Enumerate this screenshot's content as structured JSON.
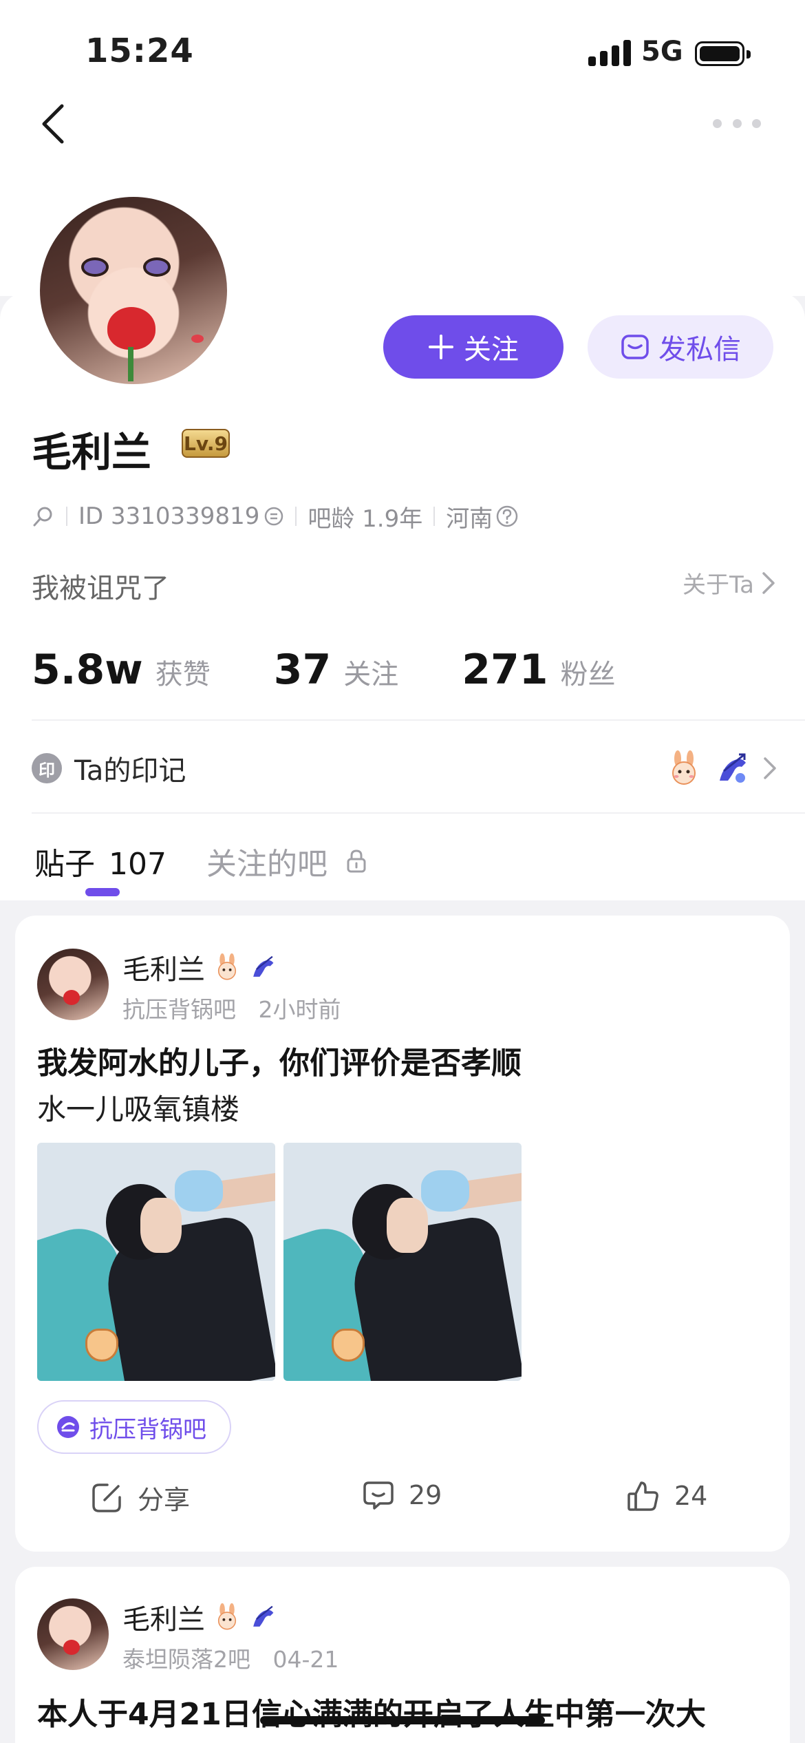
{
  "status_bar": {
    "time": "15:24",
    "network": "5G"
  },
  "profile": {
    "name": "毛利兰",
    "level": "Lv.9",
    "id_text": "ID 3310339819",
    "bar_age": "吧龄 1.9年",
    "location": "河南",
    "bio": "我被诅咒了",
    "about_label": "关于Ta",
    "follow_label": "关注",
    "message_label": "发私信"
  },
  "stats": [
    {
      "value": "5.8w",
      "label": "获赞"
    },
    {
      "value": "37",
      "label": "关注"
    },
    {
      "value": "271",
      "label": "粉丝"
    }
  ],
  "marks": {
    "label": "Ta的印记",
    "icon_text": "印"
  },
  "tabs": {
    "posts_label": "贴子",
    "posts_count": "107",
    "followed_bars": "关注的吧"
  },
  "posts": [
    {
      "author": "毛利兰",
      "bar": "抗压背锅吧",
      "time": "2小时前",
      "title": "我发阿水的儿子，你们评价是否孝顺",
      "body": "水一儿吸氧镇楼",
      "tag": "抗压背锅吧",
      "share_label": "分享",
      "comments": "29",
      "likes": "24"
    },
    {
      "author": "毛利兰",
      "bar": "泰坦陨落2吧",
      "time": "04-21",
      "title": "本人于4月21日信心满满的开启了人生中第一次大"
    }
  ],
  "colors": {
    "accent": "#6f4dea",
    "accent_light": "#efebfd"
  }
}
